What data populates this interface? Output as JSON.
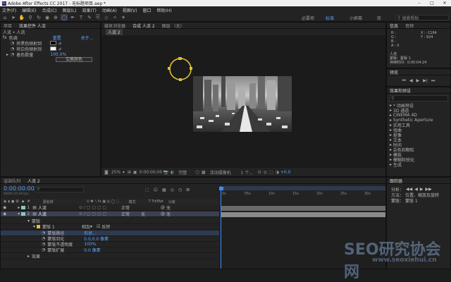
{
  "window": {
    "title": "Adobe After Effects CC 2017 - 无标题项目.aep *"
  },
  "menu": [
    "文件(F)",
    "编辑(E)",
    "合成(C)",
    "图层(L)",
    "效果(T)",
    "动画(A)",
    "视图(V)",
    "窗口",
    "帮助(H)"
  ],
  "workspaces": [
    "必要项",
    "标准",
    "小屏幕",
    "库"
  ],
  "search_placeholder": "搜索帮助",
  "left_panel": {
    "tabs": [
      "项目",
      "效果控件 人流"
    ],
    "breadcrumb": "人流 • 人流",
    "fx_name": "色调",
    "reset_label": "重置",
    "about_label": "关于...",
    "map_black": "将黑色映射到",
    "map_white": "将白色映射到",
    "amount_label": "着色数量",
    "amount_value": "100.0%",
    "swap_button": "交换颜色"
  },
  "viewer": {
    "tabs": [
      "媒体浏览器",
      "合成 人流 2",
      "图层 （无）"
    ],
    "comp_label": "人流 2",
    "zoom": "25%",
    "timecode": "0:00:00:00",
    "resolution": "完整",
    "camera": "活动摄像机",
    "views": "1 个...",
    "exposure": "+0.0"
  },
  "info_panel": {
    "tabs": [
      "信息",
      "音频"
    ],
    "r": "R :",
    "g": "G :",
    "b": "B :",
    "a": "A : 0",
    "x": "X : -1164",
    "y": "Y : 924",
    "layer": "人流",
    "mask": "蒙版：蒙版 1",
    "duration": "持续时间：0:00:04:24"
  },
  "preview": {
    "title": "预览"
  },
  "effects_panel": {
    "title": "效果和预设",
    "items": [
      "* 动画预设",
      "3D 通道",
      "CINEMA 4D",
      "Synthetic Aperture",
      "实用工具",
      "扭曲",
      "抠像",
      "文本",
      "时间",
      "杂色和颗粒",
      "模拟",
      "模糊和锐化",
      "生成"
    ]
  },
  "align_panel": {
    "title": "跟踪器",
    "split_label": "分析：",
    "method_label": "方法：",
    "method_value": "位置、缩放及旋转",
    "mask_label": "蒙版：",
    "mask_value": "蒙版 1"
  },
  "timeline": {
    "tabs": [
      "渲染队列",
      "人流 2"
    ],
    "timecode": "0:00:00:00",
    "fps": "00000 (25.00 fps)",
    "col_name": "源名称",
    "col_mode": "模式",
    "col_trkmat": "T TrkMat",
    "col_parent": "父级",
    "layers": [
      {
        "num": "1",
        "name": "人流",
        "mode": "正常",
        "trk": "",
        "parent": "无"
      },
      {
        "num": "2",
        "name": "人流",
        "mode": "正常",
        "trk": "无",
        "parent": "无"
      }
    ],
    "mask_group": "蒙版",
    "mask_name": "蒙版 1",
    "mask_mode": "相加",
    "mask_invert": "反转",
    "mask_path": "蒙版路径",
    "mask_path_value": "形状...",
    "mask_feather": "蒙版羽化",
    "mask_feather_value": "0.0,0.0 像素",
    "mask_opacity": "蒙版不透明度",
    "mask_opacity_value": "100%",
    "mask_expansion": "蒙版扩展",
    "mask_expansion_value": "0.0 像素",
    "effects_group": "效果",
    "ruler": [
      "0s",
      "05s",
      "10s",
      "15s",
      "20s",
      "25s",
      "30s"
    ]
  },
  "watermark": {
    "big": "SEO研究协会网",
    "url": "www.seoxiehui.cn"
  }
}
